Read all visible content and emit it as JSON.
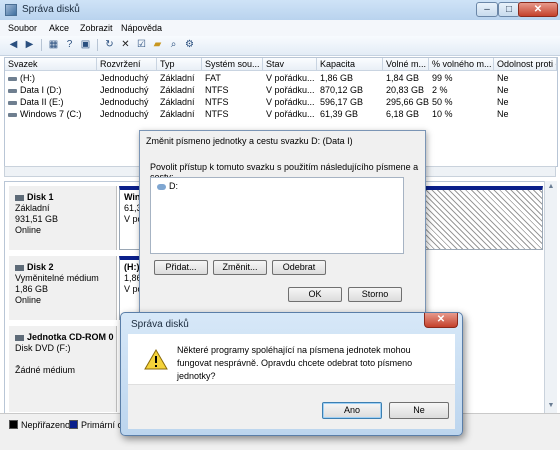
{
  "window": {
    "title": "Správa disků",
    "controls": {
      "minimize": "–",
      "maximize": "□",
      "close": "✕"
    }
  },
  "menu": [
    "Soubor",
    "Akce",
    "Zobrazit",
    "Nápověda"
  ],
  "toolbar": {
    "icons": [
      "back-arrow",
      "forward-arrow",
      "properties",
      "help",
      "refresh",
      "delete",
      "check",
      "folder-open",
      "search-magnifier",
      "settings"
    ]
  },
  "table": {
    "columns": [
      "Svazek",
      "Rozvržení",
      "Typ",
      "Systém sou...",
      "Stav",
      "Kapacita",
      "Volné m...",
      "% volného m...",
      "Odolnost proti c"
    ],
    "rows": [
      [
        "(H:)",
        "Jednoduchý",
        "Základní",
        "FAT",
        "V pořádku...",
        "1,86 GB",
        "1,84 GB",
        "99 %",
        "Ne"
      ],
      [
        "Data I (D:)",
        "Jednoduchý",
        "Základní",
        "NTFS",
        "V pořádku...",
        "870,12 GB",
        "20,83 GB",
        "2 %",
        "Ne"
      ],
      [
        "Data II (E:)",
        "Jednoduchý",
        "Základní",
        "NTFS",
        "V pořádku...",
        "596,17 GB",
        "295,66 GB",
        "50 %",
        "Ne"
      ],
      [
        "Windows 7 (C:)",
        "Jednoduchý",
        "Základní",
        "NTFS",
        "V pořádku...",
        "61,39 GB",
        "6,18 GB",
        "10 %",
        "Ne"
      ]
    ]
  },
  "disks": [
    {
      "name": "Disk 1",
      "type": "Základní",
      "size": "931,51 GB",
      "status": "Online",
      "partition": {
        "name": "Winc",
        "size": "61,39",
        "status": "V pořá"
      }
    },
    {
      "name": "Disk 2",
      "type": "Vyměnitelné médium",
      "size": "1,86 GB",
      "status": "Online",
      "partition": {
        "name": "(H:)",
        "size": "1,86 G",
        "status": "V pořá"
      }
    },
    {
      "name": "Jednotka CD-ROM 0",
      "type": "Disk DVD (F:)",
      "size": "",
      "status": "Žádné médium"
    }
  ],
  "legend": [
    {
      "label": "Nepřiřazeno",
      "color": "#000000"
    },
    {
      "label": "Primární oddí",
      "color": "#0a1f8a"
    }
  ],
  "dialog_letter": {
    "title": "Změnit písmeno jednotky a cestu svazku D: (Data I)",
    "description": "Povolit přístup k tomuto svazku s použitím následujícího písmene a cesty:",
    "items": [
      "D:"
    ],
    "buttons": {
      "add": "Přidat...",
      "change": "Změnit...",
      "remove": "Odebrat",
      "ok": "OK",
      "cancel": "Storno"
    }
  },
  "dialog_confirm": {
    "title": "Správa disků",
    "message": "Některé programy spoléhající na písmena jednotek mohou fungovat nesprávně. Opravdu chcete odebrat toto písmeno jednotky?",
    "buttons": {
      "yes": "Ano",
      "no": "Ne"
    },
    "close": "✕",
    "icon": "warning-icon"
  }
}
